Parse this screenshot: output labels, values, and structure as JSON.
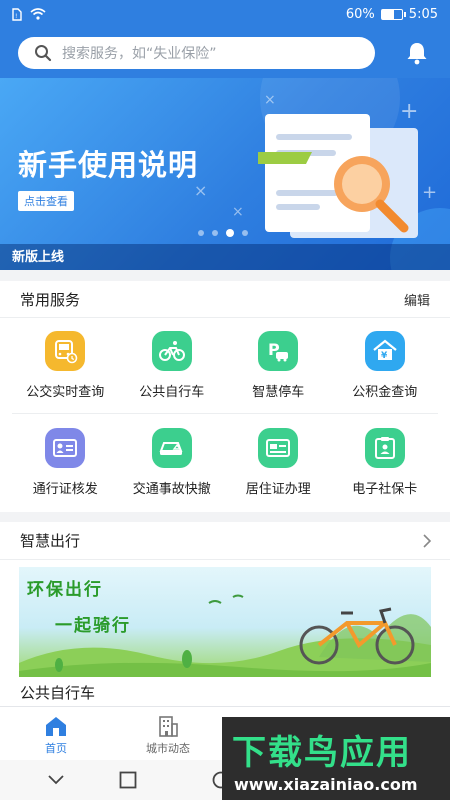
{
  "status": {
    "battery": "60%",
    "battery_level": 0.6,
    "time": "5:05"
  },
  "search": {
    "placeholder": "搜索服务，如“失业保险”"
  },
  "banner": {
    "title": "新手使用说明",
    "button": "点击查看",
    "caption": "新版上线",
    "slides": 4,
    "active_slide": 3
  },
  "services": {
    "title": "常用服务",
    "edit": "编辑",
    "items": [
      {
        "label": "公交实时查询",
        "icon": "bus-icon",
        "color": "#f5b82e"
      },
      {
        "label": "公共自行车",
        "icon": "bicycle-icon",
        "color": "#3ccf8e"
      },
      {
        "label": "智慧停车",
        "icon": "parking-icon",
        "color": "#3ccf8e"
      },
      {
        "label": "公积金查询",
        "icon": "housing-fund-icon",
        "color": "#2fa8f0"
      },
      {
        "label": "通行证核发",
        "icon": "id-card-icon",
        "color": "#7f88e8"
      },
      {
        "label": "交通事故快撤",
        "icon": "car-accident-icon",
        "color": "#3ccf8e"
      },
      {
        "label": "居住证办理",
        "icon": "residence-permit-icon",
        "color": "#3ccf8e"
      },
      {
        "label": "电子社保卡",
        "icon": "social-security-card-icon",
        "color": "#3ccf8e"
      }
    ]
  },
  "travel": {
    "title": "智慧出行",
    "banner_line1": "环保出行",
    "banner_line2": "一起骑行",
    "caption": "公共自行车"
  },
  "tabs": [
    {
      "label": "首页",
      "icon": "home-icon",
      "active": true
    },
    {
      "label": "城市动态",
      "icon": "building-icon",
      "active": false
    }
  ],
  "watermark": {
    "title": "下载鸟应用",
    "url": "www.xiazainiao.com"
  },
  "colors": {
    "primary": "#2f7fe0",
    "green": "#3ccf8e",
    "yellow": "#f5b82e"
  }
}
